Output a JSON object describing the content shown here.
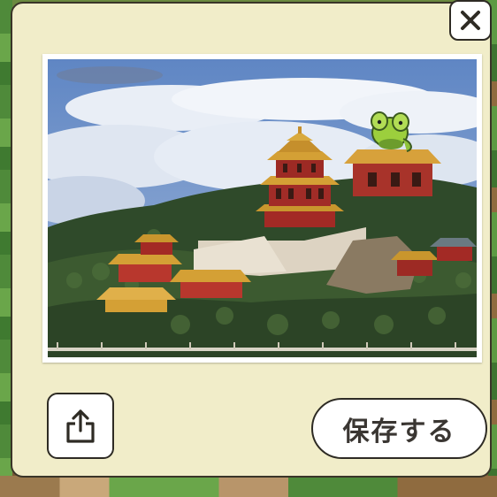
{
  "modal": {
    "close_icon": "close-icon",
    "photo": {
      "subject": "photo"
    },
    "share_icon": "share-icon",
    "save_label": "保存する"
  },
  "colors": {
    "card_background": "#f1edc9",
    "border": "#2e2b24",
    "button_fill": "#ffffff",
    "label_text": "#3a3632"
  }
}
